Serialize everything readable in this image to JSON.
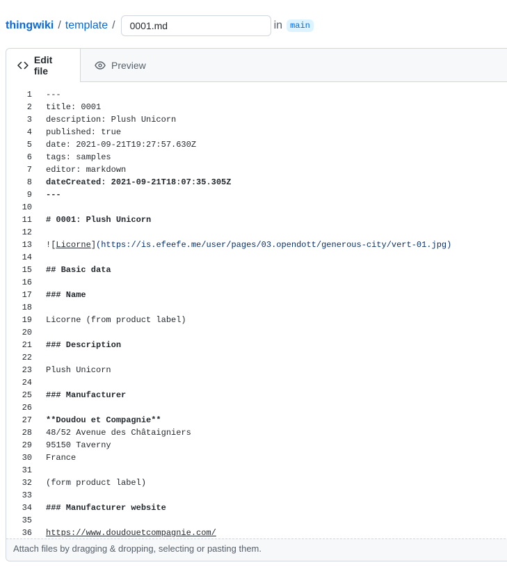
{
  "breadcrumb": {
    "owner": "thingwiki",
    "separator": "/",
    "repo": "template"
  },
  "filename_input": {
    "value": "0001.md"
  },
  "branch": {
    "in_label": "in",
    "name": "main"
  },
  "tabs": [
    {
      "label": "Edit file",
      "icon": "code-icon",
      "active": true
    },
    {
      "label": "Preview",
      "icon": "eye-icon",
      "active": false
    }
  ],
  "code_lines": [
    "---",
    "title: 0001",
    "description: Plush Unicorn",
    "published: true",
    "date: 2021-09-21T19:27:57.630Z",
    "tags: samples",
    "editor: markdown",
    "dateCreated: 2021-09-21T18:07:35.305Z",
    "---",
    "",
    "# 0001: Plush Unicorn",
    "",
    "![Licorne](https://is.efeefe.me/user/pages/03.opendott/generous-city/vert-01.jpg)",
    "",
    "## Basic data",
    "",
    "### Name",
    "",
    "Licorne (from product label)",
    "",
    "### Description",
    "",
    "Plush Unicorn",
    "",
    "### Manufacturer",
    "",
    "**Doudou et Compagnie**",
    "48/52 Avenue des Châtaigniers",
    "95150 Taverny",
    "France",
    "",
    "(form product label)",
    "",
    "### Manufacturer website",
    "",
    "https://www.doudouetcompagnie.com/"
  ],
  "attach_hint": "Attach files by dragging & dropping, selecting or pasting them."
}
